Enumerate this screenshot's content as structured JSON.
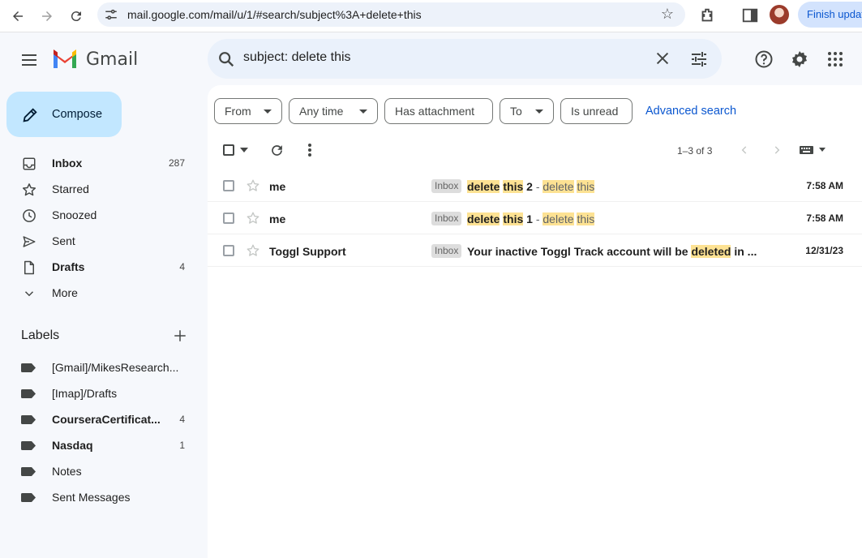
{
  "browser": {
    "url": "mail.google.com/mail/u/1/#search/subject%3A+delete+this",
    "update_button": "Finish update"
  },
  "app": {
    "name": "Gmail"
  },
  "search": {
    "query": "subject: delete this"
  },
  "compose": {
    "label": "Compose"
  },
  "nav": [
    {
      "label": "Inbox",
      "count": "287",
      "bold": true,
      "icon": "inbox-icon"
    },
    {
      "label": "Starred",
      "count": "",
      "bold": false,
      "icon": "star-icon"
    },
    {
      "label": "Snoozed",
      "count": "",
      "bold": false,
      "icon": "clock-icon"
    },
    {
      "label": "Sent",
      "count": "",
      "bold": false,
      "icon": "send-icon"
    },
    {
      "label": "Drafts",
      "count": "4",
      "bold": true,
      "icon": "draft-icon"
    },
    {
      "label": "More",
      "count": "",
      "bold": false,
      "icon": "chevron-down-icon"
    }
  ],
  "labels": {
    "heading": "Labels",
    "items": [
      {
        "label": "[Gmail]/MikesResearch...",
        "count": "",
        "bold": false
      },
      {
        "label": "[Imap]/Drafts",
        "count": "",
        "bold": false
      },
      {
        "label": "CourseraCertificat...",
        "count": "4",
        "bold": true
      },
      {
        "label": "Nasdaq",
        "count": "1",
        "bold": true
      },
      {
        "label": "Notes",
        "count": "",
        "bold": false
      },
      {
        "label": "Sent Messages",
        "count": "",
        "bold": false
      }
    ]
  },
  "filters": {
    "from": "From",
    "any_time": "Any time",
    "has_attachment": "Has attachment",
    "to": "To",
    "is_unread": "Is unread",
    "advanced": "Advanced search"
  },
  "pager": {
    "text": "1–3 of 3"
  },
  "emails": [
    {
      "sender": "me",
      "badge": "Inbox",
      "subject_parts": [
        "delete",
        " ",
        "this",
        " 2"
      ],
      "snippet_parts": [
        "delete",
        " ",
        "this"
      ],
      "date": "7:58 AM"
    },
    {
      "sender": "me",
      "badge": "Inbox",
      "subject_parts": [
        "delete",
        " ",
        "this",
        " 1"
      ],
      "snippet_parts": [
        "delete",
        " ",
        "this"
      ],
      "date": "7:58 AM"
    },
    {
      "sender": "Toggl Support",
      "badge": "Inbox",
      "subject_parts": [
        "Your inactive Toggl Track account will be ",
        "deleted",
        " in ..."
      ],
      "date": "12/31/23"
    }
  ],
  "colors": {
    "accent": "#0b57d0",
    "compose_bg": "#c2e7ff",
    "highlight": "#fde293"
  }
}
